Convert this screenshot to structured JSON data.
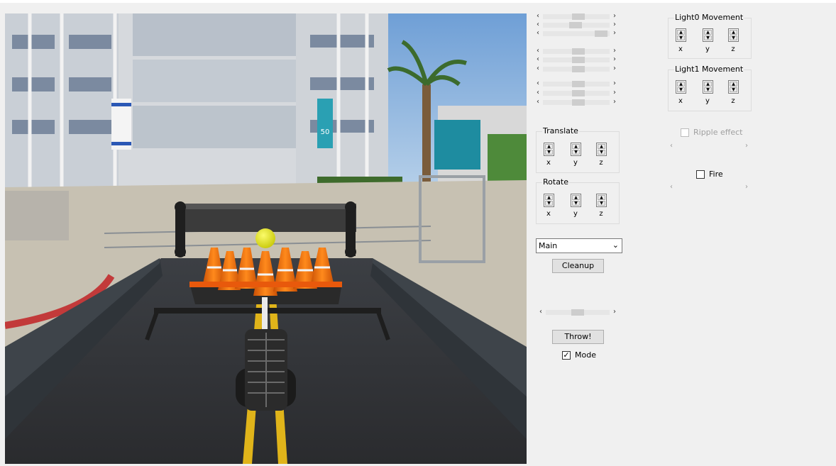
{
  "left_sliders": [
    {
      "value": 0.55
    },
    {
      "value": 0.45
    },
    {
      "value": 0.92
    },
    {
      "value": 0.55
    },
    {
      "value": 0.55
    },
    {
      "value": 0.55
    },
    {
      "value": 0.55
    },
    {
      "value": 0.55
    },
    {
      "value": 0.55
    }
  ],
  "translate": {
    "title": "Translate",
    "axes": [
      "x",
      "y",
      "z"
    ]
  },
  "rotate": {
    "title": "Rotate",
    "axes": [
      "x",
      "y",
      "z"
    ]
  },
  "view_select": {
    "value": "Main"
  },
  "cleanup_label": "Cleanup",
  "throw_slider": {
    "value": 0.5
  },
  "throw_label": "Throw!",
  "mode": {
    "label": "Mode",
    "checked": true
  },
  "light0": {
    "title": "Light0 Movement",
    "axes": [
      "x",
      "y",
      "z"
    ]
  },
  "light1": {
    "title": "Light1 Movement",
    "axes": [
      "x",
      "y",
      "z"
    ]
  },
  "ripple": {
    "label": "Ripple effect",
    "enabled": false
  },
  "fire": {
    "label": "Fire",
    "checked": false
  },
  "scene_sign_text": "50",
  "colors": {
    "cone": "#f26a0a",
    "ball": "#e6e619",
    "road_line": "#e0b41a",
    "sky": "#7aa8d8"
  }
}
